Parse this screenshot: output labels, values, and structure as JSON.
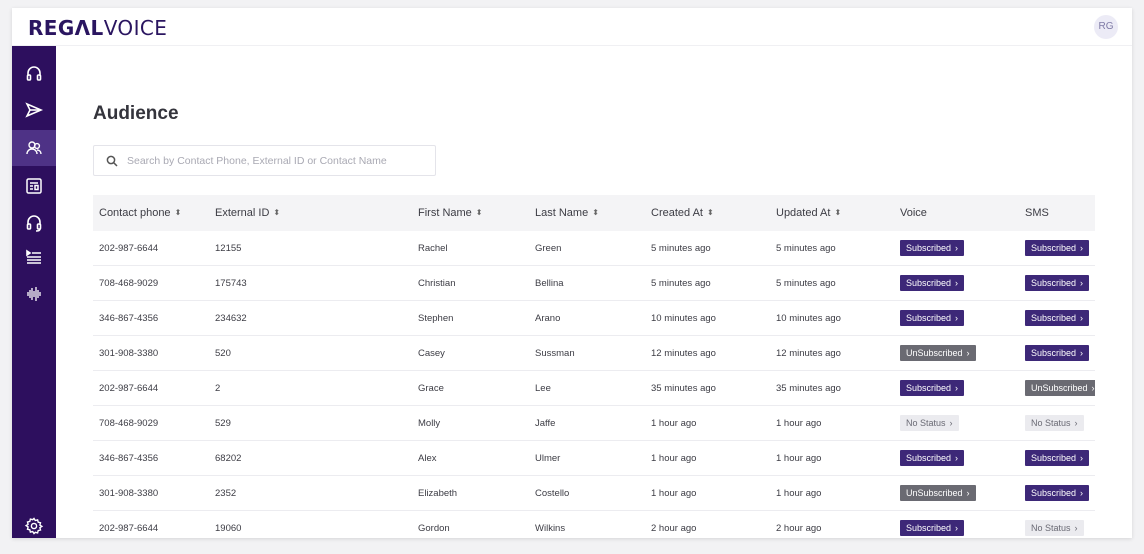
{
  "brand": {
    "logo_part1": "REGΛL",
    "logo_part2": "VOICE"
  },
  "user": {
    "initials": "RG"
  },
  "sidebar": {
    "items": [
      {
        "icon": "headset-icon"
      },
      {
        "icon": "send-icon"
      },
      {
        "icon": "audience-icon",
        "active": true
      },
      {
        "icon": "contact-card-icon"
      },
      {
        "icon": "agent-headset-icon"
      },
      {
        "icon": "queue-list-icon"
      },
      {
        "icon": "waveform-icon"
      }
    ],
    "settings_icon": "gear-icon"
  },
  "page": {
    "title": "Audience"
  },
  "search": {
    "placeholder": "Search by Contact Phone, External ID or Contact Name"
  },
  "table": {
    "columns": [
      {
        "label": "Contact phone",
        "sortable": true
      },
      {
        "label": "External ID",
        "sortable": true
      },
      {
        "label": "First Name",
        "sortable": true
      },
      {
        "label": "Last Name",
        "sortable": true
      },
      {
        "label": "Created At",
        "sortable": true
      },
      {
        "label": "Updated At",
        "sortable": true
      },
      {
        "label": "Voice",
        "sortable": false
      },
      {
        "label": "SMS",
        "sortable": false
      }
    ],
    "rows": [
      {
        "phone": "202-987-6644",
        "external_id": "12155",
        "first": "Rachel",
        "last": "Green",
        "created": "5 minutes ago",
        "updated": "5 minutes ago",
        "voice": "Subscribed",
        "sms": "Subscribed"
      },
      {
        "phone": "708-468-9029",
        "external_id": "175743",
        "first": "Christian",
        "last": "Bellina",
        "created": "5 minutes ago",
        "updated": "5 minutes ago",
        "voice": "Subscribed",
        "sms": "Subscribed"
      },
      {
        "phone": "346-867-4356",
        "external_id": "234632",
        "first": "Stephen",
        "last": "Arano",
        "created": "10 minutes ago",
        "updated": "10 minutes ago",
        "voice": "Subscribed",
        "sms": "Subscribed"
      },
      {
        "phone": "301-908-3380",
        "external_id": "520",
        "first": "Casey",
        "last": "Sussman",
        "created": "12 minutes ago",
        "updated": "12 minutes ago",
        "voice": "UnSubscribed",
        "sms": "Subscribed"
      },
      {
        "phone": "202-987-6644",
        "external_id": "2",
        "first": "Grace",
        "last": "Lee",
        "created": "35 minutes ago",
        "updated": "35 minutes ago",
        "voice": "Subscribed",
        "sms": "UnSubscribed"
      },
      {
        "phone": "708-468-9029",
        "external_id": "529",
        "first": "Molly",
        "last": "Jaffe",
        "created": "1 hour ago",
        "updated": "1 hour ago",
        "voice": "No Status",
        "sms": "No Status"
      },
      {
        "phone": "346-867-4356",
        "external_id": "68202",
        "first": "Alex",
        "last": "Ulmer",
        "created": "1 hour ago",
        "updated": "1 hour ago",
        "voice": "Subscribed",
        "sms": "Subscribed"
      },
      {
        "phone": "301-908-3380",
        "external_id": "2352",
        "first": "Elizabeth",
        "last": "Costello",
        "created": "1 hour ago",
        "updated": "1 hour ago",
        "voice": "UnSubscribed",
        "sms": "Subscribed"
      },
      {
        "phone": "202-987-6644",
        "external_id": "19060",
        "first": "Gordon",
        "last": "Wilkins",
        "created": "2 hour ago",
        "updated": "2 hour ago",
        "voice": "Subscribed",
        "sms": "No Status"
      }
    ]
  },
  "colors": {
    "sidebar_bg": "#2d0f5e",
    "sidebar_active": "#4e3286",
    "badge_subscribed": "#3d2878",
    "badge_unsubscribed": "#6a6a72",
    "badge_no_status": "#ebebef"
  }
}
